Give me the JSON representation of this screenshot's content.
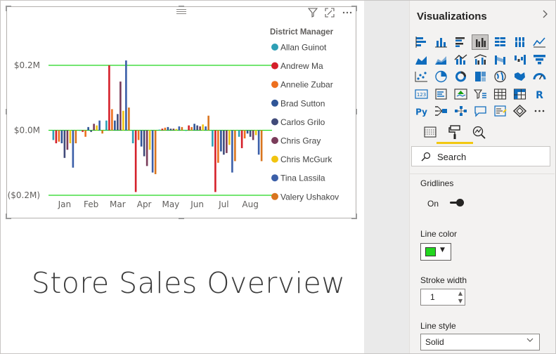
{
  "report": {
    "title": "Store Sales Overview"
  },
  "pane": {
    "title": "Visualizations",
    "search_placeholder": "Search",
    "gridlines_label": "Gridlines",
    "toggle_label": "On",
    "line_color_label": "Line color",
    "line_color": "#22d61f",
    "stroke_width_label": "Stroke width",
    "stroke_width_value": "1",
    "line_style_label": "Line style",
    "line_style_value": "Solid",
    "tab_accent": "#f2c811",
    "viz_icons": [
      "stacked-bar-icon",
      "stacked-column-icon",
      "clustered-bar-icon",
      "clustered-column-icon",
      "100-stacked-bar-icon",
      "100-stacked-column-icon",
      "line-chart-icon",
      "area-chart-icon",
      "stacked-area-icon",
      "line-column-icon",
      "line-clustered-column-icon",
      "ribbon-chart-icon",
      "waterfall-icon",
      "funnel-icon",
      "scatter-icon",
      "pie-chart-icon",
      "donut-icon",
      "treemap-icon",
      "map-icon",
      "filled-map-icon",
      "gauge-icon",
      "card-icon",
      "multi-row-card-icon",
      "kpi-icon",
      "slicer-icon",
      "table-icon",
      "matrix-icon",
      "r-visual-icon",
      "python-visual-icon",
      "key-influencers-icon",
      "decomposition-tree-icon",
      "qa-icon",
      "smart-narrative-icon",
      "power-apps-icon",
      "more-icon"
    ],
    "selected_icon_index": 3
  },
  "chart_data": {
    "type": "bar",
    "title": "",
    "xlabel": "",
    "ylabel": "",
    "categories": [
      "Jan",
      "Feb",
      "Mar",
      "Apr",
      "May",
      "Jun",
      "Jul",
      "Aug"
    ],
    "y_ticks": [
      "$0.2M",
      "$0.0M",
      "($0.2M)"
    ],
    "ylim": [
      -0.2,
      0.2
    ],
    "gridlines": true,
    "gridline_color": "#22d61f",
    "legend_title": "District Manager",
    "legend_position": "right",
    "series": [
      {
        "name": "Allan Guinot",
        "color": "#2e9fb5",
        "values": [
          -0.03,
          0.0,
          0.03,
          -0.04,
          0.002,
          0.0,
          -0.05,
          -0.02
        ]
      },
      {
        "name": "Andrew Ma",
        "color": "#d5202a",
        "values": [
          -0.04,
          -0.005,
          0.2,
          -0.19,
          0.005,
          0.015,
          -0.19,
          -0.055
        ]
      },
      {
        "name": "Annelie Zubar",
        "color": "#ed6f1e",
        "values": [
          -0.035,
          -0.02,
          0.065,
          -0.03,
          0.008,
          0.01,
          -0.1,
          -0.025
        ]
      },
      {
        "name": "Brad Sutton",
        "color": "#2f5597",
        "values": [
          -0.04,
          0.01,
          0.03,
          -0.05,
          0.01,
          0.02,
          -0.065,
          -0.01
        ]
      },
      {
        "name": "Carlos Grilo",
        "color": "#414b7a",
        "values": [
          -0.085,
          -0.005,
          0.05,
          -0.08,
          0.005,
          0.015,
          -0.075,
          -0.02
        ]
      },
      {
        "name": "Chris Gray",
        "color": "#7a3c5a",
        "values": [
          -0.06,
          0.02,
          0.15,
          -0.11,
          0.005,
          0.012,
          -0.07,
          -0.03
        ]
      },
      {
        "name": "Chris McGurk",
        "color": "#f1c40f",
        "values": [
          -0.04,
          0.015,
          0.06,
          -0.06,
          0.004,
          0.018,
          -0.045,
          -0.015
        ]
      },
      {
        "name": "Tina Lassila",
        "color": "#3b5fa8",
        "values": [
          -0.115,
          0.03,
          0.215,
          -0.13,
          0.012,
          0.012,
          -0.13,
          -0.075
        ]
      },
      {
        "name": "Valery Ushakov",
        "color": "#d9751f",
        "values": [
          -0.04,
          -0.01,
          0.07,
          -0.135,
          0.01,
          0.045,
          -0.095,
          -0.095
        ]
      }
    ]
  }
}
